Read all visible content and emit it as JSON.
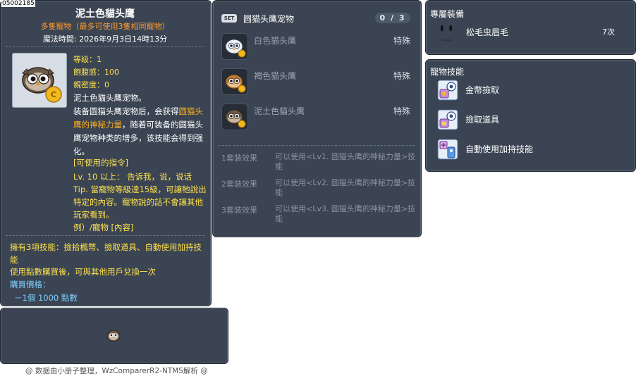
{
  "item_id": "05002185",
  "main": {
    "title": "泥土色貓头鹰",
    "subtitle": "多隻寵物（最多可使用3隻相同寵物）",
    "magic_time": "魔法時間:  2026年9月3日14時13分",
    "stats": {
      "level": "等级：1",
      "fullness": "飽腹感：100",
      "intimacy": "親密度：0"
    },
    "desc": {
      "line1": "泥土色貓头鹰宠物。",
      "line2a": "装备圆猫头鹰宠物后，会获得",
      "line2hl": "圆猫头鹰的神秘力量",
      "line2b": "，随着可装备的圆猫头鹰宠物种类的增多，该技能会得到强化。"
    },
    "commands_header": "[可使用的指令]",
    "commands": [
      "Lv. 10 以上：  告诉我，说，说话",
      "Tip. 當寵物等級達15級，可讓牠說出特定的內容。寵物說的話不會讓其他玩家看到。",
      "例）/寵物 [內容]"
    ],
    "skills_line": "擁有3項技能：撿拾楓幣、撿取道具、自動使用加持技能",
    "resale_line": "使用點數購買後，可與其他用戶兌換一次",
    "price_label": "購買價格：",
    "price_value": "－1個 1000 點數"
  },
  "set": {
    "badge": "SET",
    "title": "圆猫头鹰宠物",
    "count": "0 / 3",
    "items": [
      {
        "name": "白色猫头鹰",
        "type": "特殊"
      },
      {
        "name": "褐色猫头鹰",
        "type": "特殊"
      },
      {
        "name": "泥土色貓头鹰",
        "type": "特殊"
      }
    ],
    "effects": [
      {
        "label": "1套装效果",
        "text": "可以使用<Lv1.  圆猫头鹰的神秘力量>技能"
      },
      {
        "label": "2套装效果",
        "text": "可以使用<Lv2.  圆猫头鹰的神秘力量>技能"
      },
      {
        "label": "3套装效果",
        "text": "可以使用<Lv3.  圆猫头鹰的神秘力量>技能"
      }
    ]
  },
  "exclusive": {
    "title": "專屬裝備",
    "item_name": "松毛虫眉毛",
    "item_count": "7次"
  },
  "pet_skills": {
    "title": "寵物技能",
    "skills": [
      {
        "name": "金幣撿取",
        "icon": "coin-pickup-icon"
      },
      {
        "name": "撿取道具",
        "icon": "item-pickup-icon"
      },
      {
        "name": "自動使用加持技能",
        "icon": "auto-buff-icon"
      }
    ]
  },
  "footer": "@ 数据由小册子整理，WzComparerR2-NTMS解析 @",
  "colors": {
    "panel_bg": "#3a4452",
    "title_orange": "#ff9a2e",
    "stat_yellow": "#ffe14d",
    "highlight_orange": "#ffb020",
    "price_blue": "#7fd0ff"
  }
}
